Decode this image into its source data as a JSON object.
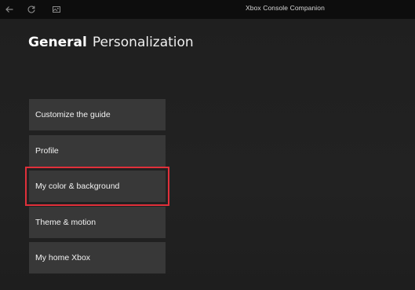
{
  "window": {
    "title": "Xbox Console Companion",
    "icons": [
      "back-arrow-icon",
      "refresh-icon",
      "snapshot-icon"
    ]
  },
  "header": {
    "section": "General",
    "subsection": "Personalization"
  },
  "menu": {
    "items": [
      {
        "label": "Customize the guide"
      },
      {
        "label": "Profile"
      },
      {
        "label": "My color & background",
        "highlighted": true
      },
      {
        "label": "Theme & motion"
      },
      {
        "label": "My home Xbox"
      }
    ]
  },
  "colors": {
    "highlight": "#e0303a",
    "tile": "#383838",
    "background": "#1f1f1f"
  }
}
